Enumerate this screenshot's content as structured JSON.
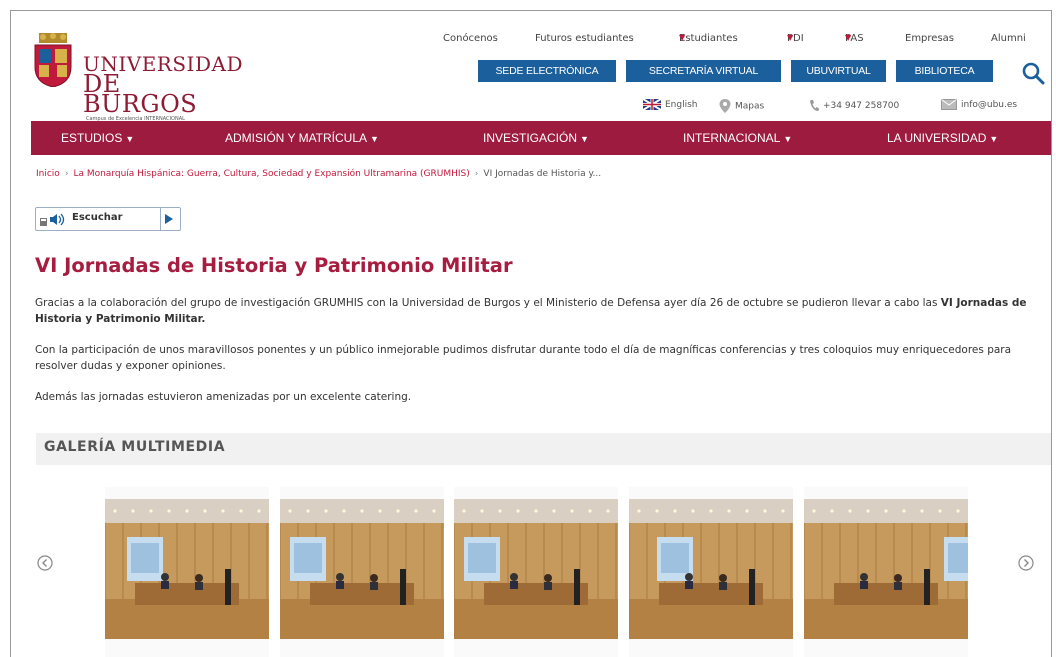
{
  "header": {
    "university_line1": "UNIVERSIDAD",
    "university_line2": "DE BURGOS",
    "campus_tagline": "Campus de Excelencia INTERNACIONAL",
    "top_links": [
      {
        "label": "Conócenos",
        "caret": false
      },
      {
        "label": "Futuros estudiantes",
        "caret": false
      },
      {
        "label": "Estudiantes",
        "caret": true
      },
      {
        "label": "PDI",
        "caret": true
      },
      {
        "label": "PAS",
        "caret": true
      },
      {
        "label": "Empresas",
        "caret": false
      },
      {
        "label": "Alumni",
        "caret": false
      }
    ],
    "blue_buttons": [
      "SEDE ELECTRÓNICA",
      "SECRETARÍA VIRTUAL",
      "UBUVIRTUAL",
      "BIBLIOTECA"
    ],
    "contact": {
      "english": "English",
      "maps": "Mapas",
      "phone": "+34 947 258700",
      "email": "info@ubu.es"
    },
    "caret_symbol": "▼"
  },
  "main_nav": {
    "items": [
      "ESTUDIOS",
      "ADMISIÓN Y MATRÍCULA",
      "INVESTIGACIÓN",
      "INTERNACIONAL",
      "LA UNIVERSIDAD"
    ]
  },
  "breadcrumb": {
    "items": [
      "Inicio",
      "La Monarquía Hispánica: Guerra, Cultura, Sociedad y Expansión Ultramarina (GRUMHIS)"
    ],
    "separator": "›",
    "current": "VI Jornadas de Historia y..."
  },
  "listen": {
    "label": "Escuchar"
  },
  "article": {
    "title": "VI Jornadas de Historia y Patrimonio Militar",
    "p1_before": "Gracias a la colaboración del grupo de investigación GRUMHIS con la Universidad de Burgos y el Ministerio de Defensa ayer día 26 de octubre se pudieron llevar a cabo las ",
    "p1_bold": "VI Jornadas de Historia y Patrimonio Militar.",
    "p2": "Con la participación de unos maravillosos ponentes y un público inmejorable pudimos disfrutar durante todo el día de magníficas conferencias y tres coloquios muy enriquecedores para resolver dudas y exponer opiniones.",
    "p3": "Además las jornadas estuvieron amenizadas por un excelente catering."
  },
  "gallery": {
    "title": "GALERÍA MULTIMEDIA",
    "photo_count": 5
  },
  "colors": {
    "brand": "#9d1b3f",
    "title": "#a61d3f",
    "button_blue": "#1b5f9c",
    "link": "#c0193c"
  }
}
